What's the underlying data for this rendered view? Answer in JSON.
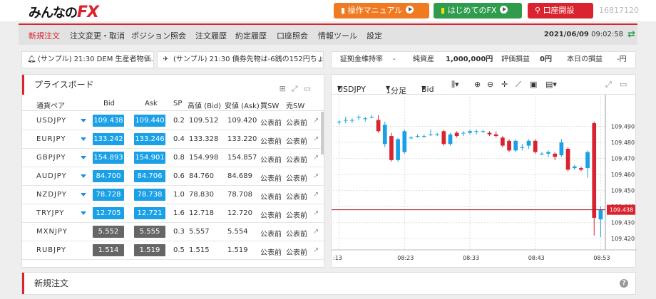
{
  "header": {
    "logo_text": "みんなの",
    "logo_fx": "FX",
    "manual_label": "操作マニュアル",
    "first_label": "はじめてのFX",
    "open_account_label": "口座開設",
    "account_id": "16817120"
  },
  "nav": {
    "items": [
      "新規注文",
      "注文変更・取消",
      "ポジション照会",
      "注文履歴",
      "約定履歴",
      "口座照会",
      "情報ツール",
      "設定"
    ],
    "active_index": 0,
    "date": "2021/06/09",
    "time": "09:02:58"
  },
  "news": {
    "item1": "(サンプル) 21:30 DEM 生産者物価…",
    "item2": "(サンプル) 21:30 債券先物は-6銭の152円ちょ…"
  },
  "stats": {
    "margin_rate_label": "証拠金維持率",
    "margin_rate_value": "-",
    "net_assets_label": "純資産",
    "net_assets_value": "1,000,000円",
    "unrealized_label": "評価損益",
    "unrealized_value": "0円",
    "today_label": "本日の損益",
    "today_value": "-円"
  },
  "price_board": {
    "title": "プライスボード",
    "headers": {
      "pair": "通貨ペア",
      "bid": "Bid",
      "ask": "Ask",
      "sp": "SP",
      "high": "高値 (Bid)",
      "low": "安値 (Ask)",
      "buy_sw": "買SW",
      "sell_sw": "売SW"
    },
    "rows": [
      {
        "sym": "USDJPY",
        "bid": "109.438",
        "ask": "109.440",
        "sp": "0.2",
        "high": "109.512",
        "low": "109.420",
        "bsw": "公表前",
        "ssw": "公表前",
        "active": true
      },
      {
        "sym": "EURJPY",
        "bid": "133.242",
        "ask": "133.246",
        "sp": "0.4",
        "high": "133.328",
        "low": "133.220",
        "bsw": "公表前",
        "ssw": "公表前",
        "active": true
      },
      {
        "sym": "GBPJPY",
        "bid": "154.893",
        "ask": "154.901",
        "sp": "0.8",
        "high": "154.998",
        "low": "154.857",
        "bsw": "公表前",
        "ssw": "公表前",
        "active": true
      },
      {
        "sym": "AUDJPY",
        "bid": "84.700",
        "ask": "84.706",
        "sp": "0.6",
        "high": "84.760",
        "low": "84.689",
        "bsw": "公表前",
        "ssw": "公表前",
        "active": true
      },
      {
        "sym": "NZDJPY",
        "bid": "78.728",
        "ask": "78.738",
        "sp": "1.0",
        "high": "78.830",
        "low": "78.708",
        "bsw": "公表前",
        "ssw": "公表前",
        "active": true
      },
      {
        "sym": "TRYJPY",
        "bid": "12.705",
        "ask": "12.721",
        "sp": "1.6",
        "high": "12.718",
        "low": "12.720",
        "bsw": "公表前",
        "ssw": "公表前",
        "active": true
      },
      {
        "sym": "MXNJPY",
        "bid": "5.552",
        "ask": "5.555",
        "sp": "0.3",
        "high": "5.557",
        "low": "5.554",
        "bsw": "公表前",
        "ssw": "公表前",
        "active": false
      },
      {
        "sym": "RUBJPY",
        "bid": "1.514",
        "ask": "1.519",
        "sp": "0.5",
        "high": "1.515",
        "low": "1.519",
        "bsw": "公表前",
        "ssw": "公表前",
        "active": false
      }
    ]
  },
  "chart_toolbar": {
    "symbol": "USDJPY",
    "interval": "1分足",
    "side": "Bid"
  },
  "chart_data": {
    "type": "candlestick",
    "symbol": "USDJPY",
    "interval": "1分足",
    "price_type": "Bid",
    "ylim": [
      109.413,
      109.508
    ],
    "y_ticks": [
      109.49,
      109.48,
      109.47,
      109.46,
      109.45,
      109.44,
      109.43,
      109.42
    ],
    "current_price_label": "109.438",
    "current_price": 109.438,
    "x_ticks": [
      ":13",
      "08:23",
      "08:33",
      "08:43",
      "08:53"
    ],
    "x_tick_index": [
      0,
      10,
      20,
      30,
      40
    ],
    "colors": {
      "up": "#1aa0e6",
      "down": "#d9232f",
      "grid": "#dddddd",
      "price_line": "#a01c2a"
    },
    "candles": [
      {
        "o": 109.493,
        "h": 109.494,
        "l": 109.491,
        "c": 109.493
      },
      {
        "o": 109.494,
        "h": 109.496,
        "l": 109.492,
        "c": 109.494
      },
      {
        "o": 109.494,
        "h": 109.495,
        "l": 109.492,
        "c": 109.494
      },
      {
        "o": 109.496,
        "h": 109.497,
        "l": 109.494,
        "c": 109.496
      },
      {
        "o": 109.495,
        "h": 109.496,
        "l": 109.493,
        "c": 109.495
      },
      {
        "o": 109.496,
        "h": 109.497,
        "l": 109.495,
        "c": 109.496
      },
      {
        "o": 109.494,
        "h": 109.497,
        "l": 109.486,
        "c": 109.487
      },
      {
        "o": 109.479,
        "h": 109.493,
        "l": 109.477,
        "c": 109.491
      },
      {
        "o": 109.484,
        "h": 109.486,
        "l": 109.468,
        "c": 109.469
      },
      {
        "o": 109.469,
        "h": 109.483,
        "l": 109.468,
        "c": 109.482
      },
      {
        "o": 109.474,
        "h": 109.488,
        "l": 109.473,
        "c": 109.487
      },
      {
        "o": 109.483,
        "h": 109.484,
        "l": 109.482,
        "c": 109.483
      },
      {
        "o": 109.484,
        "h": 109.485,
        "l": 109.483,
        "c": 109.484
      },
      {
        "o": 109.484,
        "h": 109.485,
        "l": 109.483,
        "c": 109.484
      },
      {
        "o": 109.485,
        "h": 109.488,
        "l": 109.484,
        "c": 109.485
      },
      {
        "o": 109.485,
        "h": 109.486,
        "l": 109.484,
        "c": 109.485
      },
      {
        "o": 109.487,
        "h": 109.488,
        "l": 109.478,
        "c": 109.479
      },
      {
        "o": 109.479,
        "h": 109.486,
        "l": 109.478,
        "c": 109.485
      },
      {
        "o": 109.486,
        "h": 109.487,
        "l": 109.483,
        "c": 109.484
      },
      {
        "o": 109.486,
        "h": 109.487,
        "l": 109.484,
        "c": 109.486
      },
      {
        "o": 109.486,
        "h": 109.488,
        "l": 109.485,
        "c": 109.487
      },
      {
        "o": 109.487,
        "h": 109.488,
        "l": 109.485,
        "c": 109.487
      },
      {
        "o": 109.487,
        "h": 109.488,
        "l": 109.486,
        "c": 109.487
      },
      {
        "o": 109.486,
        "h": 109.487,
        "l": 109.484,
        "c": 109.485
      },
      {
        "o": 109.485,
        "h": 109.487,
        "l": 109.483,
        "c": 109.484
      },
      {
        "o": 109.483,
        "h": 109.484,
        "l": 109.477,
        "c": 109.478
      },
      {
        "o": 109.481,
        "h": 109.482,
        "l": 109.474,
        "c": 109.475
      },
      {
        "o": 109.475,
        "h": 109.482,
        "l": 109.474,
        "c": 109.481
      },
      {
        "o": 109.477,
        "h": 109.479,
        "l": 109.475,
        "c": 109.477
      },
      {
        "o": 109.478,
        "h": 109.482,
        "l": 109.476,
        "c": 109.481
      },
      {
        "o": 109.481,
        "h": 109.482,
        "l": 109.473,
        "c": 109.474
      },
      {
        "o": 109.473,
        "h": 109.474,
        "l": 109.472,
        "c": 109.473
      },
      {
        "o": 109.473,
        "h": 109.475,
        "l": 109.471,
        "c": 109.474
      },
      {
        "o": 109.473,
        "h": 109.474,
        "l": 109.469,
        "c": 109.471
      },
      {
        "o": 109.472,
        "h": 109.482,
        "l": 109.471,
        "c": 109.48
      },
      {
        "o": 109.476,
        "h": 109.477,
        "l": 109.462,
        "c": 109.463
      },
      {
        "o": 109.464,
        "h": 109.466,
        "l": 109.463,
        "c": 109.465
      },
      {
        "o": 109.464,
        "h": 109.465,
        "l": 109.462,
        "c": 109.463
      },
      {
        "o": 109.464,
        "h": 109.475,
        "l": 109.458,
        "c": 109.474
      },
      {
        "o": 109.492,
        "h": 109.493,
        "l": 109.422,
        "c": 109.433
      },
      {
        "o": 109.432,
        "h": 109.44,
        "l": 109.421,
        "c": 109.438
      }
    ]
  }
}
